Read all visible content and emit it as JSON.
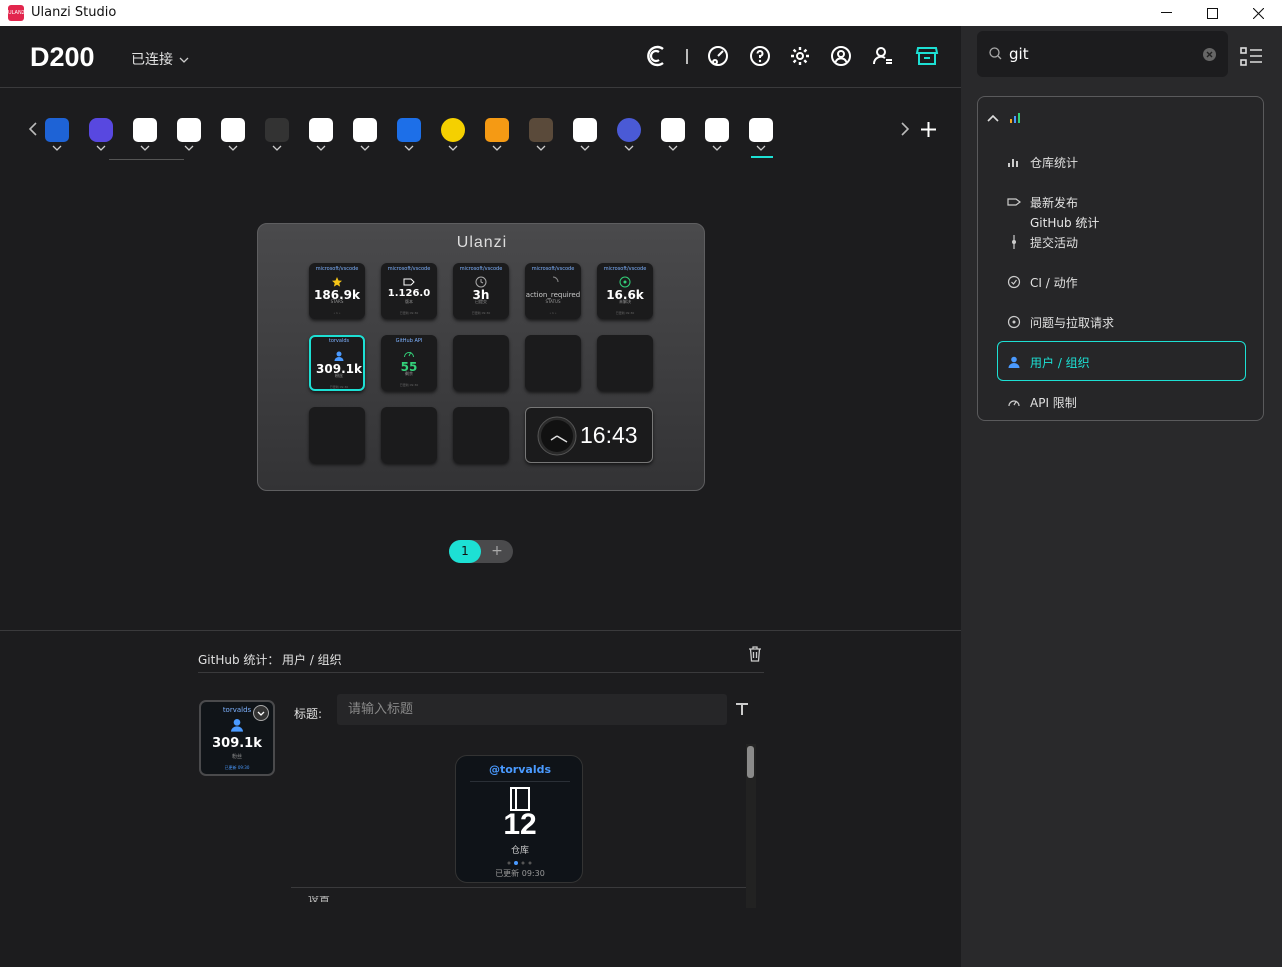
{
  "window": {
    "title": "Ulanzi Studio",
    "logo_text": "ULANZI"
  },
  "header": {
    "device_name": "D200",
    "connection_status": "已连接"
  },
  "device": {
    "brand": "Ulanzi",
    "keys": [
      {
        "repo": "microsoft/vscode",
        "value": "186.9k",
        "sub": "STARS",
        "foot": "• 1 •"
      },
      {
        "repo": "microsoft/vscode",
        "value": "1.126.0",
        "sub": "版本",
        "foot": "已更新 09:30"
      },
      {
        "repo": "microsoft/vscode",
        "value": "3h",
        "sub": "已提交",
        "foot": "已更新 09:30"
      },
      {
        "repo": "microsoft/vscode",
        "value": "action_required",
        "sub": "STATUS",
        "foot": "• 1 •"
      },
      {
        "repo": "microsoft/vscode",
        "value": "16.6k",
        "sub": "未解决",
        "foot": "已更新 09:30"
      },
      {
        "repo": "torvalds",
        "value": "309.1k",
        "sub": "粉丝",
        "foot": "已更新 09:30"
      },
      {
        "repo": "GitHub API",
        "value": "55",
        "sub": "剩余",
        "foot": "已更新 09:30"
      }
    ],
    "clock_time": "16:43"
  },
  "pager": {
    "current": "1",
    "add": "+"
  },
  "editor": {
    "breadcrumb_plugin": "GitHub 统计：",
    "breadcrumb_action": "用户 / 组织",
    "preview": {
      "user": "torvalds",
      "value": "309.1k",
      "sub": "粉丝",
      "foot": "已更新 09:30"
    },
    "title_label": "标题:",
    "title_placeholder": "请输入标题",
    "big_preview": {
      "user": "@torvalds",
      "value": "12",
      "sub": "仓库",
      "foot": "已更新 09:30"
    },
    "cut_text": "设置"
  },
  "sidebar": {
    "search_value": "git",
    "group_title": "GitHub 统计",
    "items": [
      {
        "label": "仓库统计",
        "icon": "bar-chart-icon"
      },
      {
        "label": "最新发布",
        "icon": "tag-icon"
      },
      {
        "label": "提交活动",
        "icon": "commit-icon"
      },
      {
        "label": "CI / 动作",
        "icon": "check-circle-icon"
      },
      {
        "label": "问题与拉取请求",
        "icon": "issue-icon"
      },
      {
        "label": "用户 / 组织",
        "icon": "user-icon"
      },
      {
        "label": "API 限制",
        "icon": "gauge-icon"
      }
    ]
  },
  "colors": {
    "accent": "#1de0d4",
    "link_blue": "#7eb2ff",
    "green": "#33d17a",
    "star": "#f5c518"
  }
}
